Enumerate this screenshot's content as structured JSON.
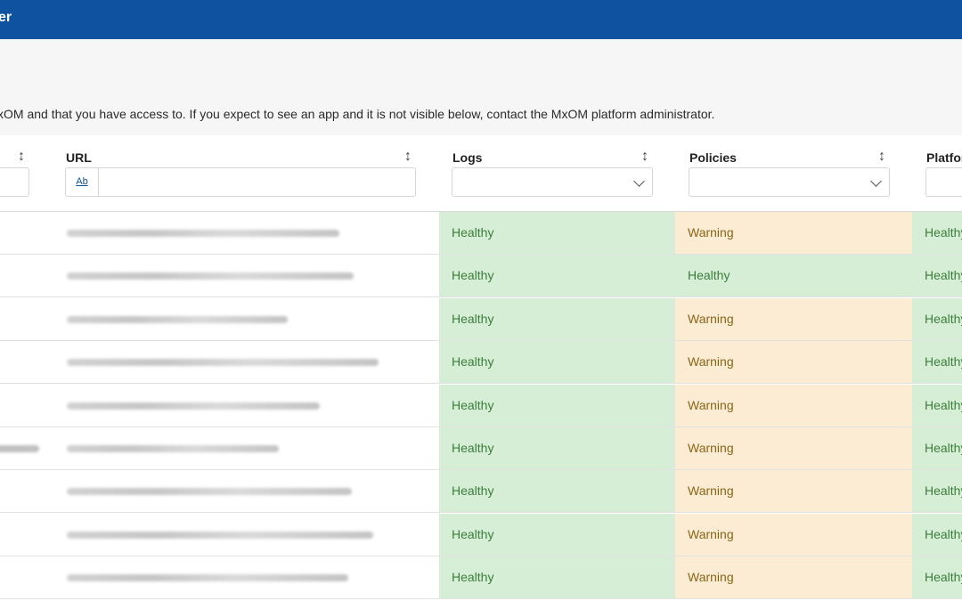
{
  "header": {
    "title": "er"
  },
  "intro_text": "xOM and that you have access to. If you expect to see an app and it is not visible below, contact the MxOM platform administrator.",
  "columns": {
    "url": {
      "label": "URL",
      "filter_toggle": "Ab"
    },
    "logs": {
      "label": "Logs"
    },
    "policies": {
      "label": "Policies"
    },
    "platform": {
      "label": "Platfor"
    }
  },
  "rows": [
    {
      "logs": "Healthy",
      "policies": "Warning",
      "platform": "Healthy"
    },
    {
      "logs": "Healthy",
      "policies": "Healthy",
      "platform": "Healthy"
    },
    {
      "logs": "Healthy",
      "policies": "Warning",
      "platform": "Healthy"
    },
    {
      "logs": "Healthy",
      "policies": "Warning",
      "platform": "Healthy"
    },
    {
      "logs": "Healthy",
      "policies": "Warning",
      "platform": "Healthy"
    },
    {
      "logs": "Healthy",
      "policies": "Warning",
      "platform": "Healthy"
    },
    {
      "logs": "Healthy",
      "policies": "Warning",
      "platform": "Healthy"
    },
    {
      "logs": "Healthy",
      "policies": "Warning",
      "platform": "Healthy"
    },
    {
      "logs": "Healthy",
      "policies": "Warning",
      "platform": "Healthy"
    }
  ],
  "colors": {
    "topbar": "#0f52a0",
    "healthy_bg": "#d6eed6",
    "warning_bg": "#fbecd3"
  }
}
